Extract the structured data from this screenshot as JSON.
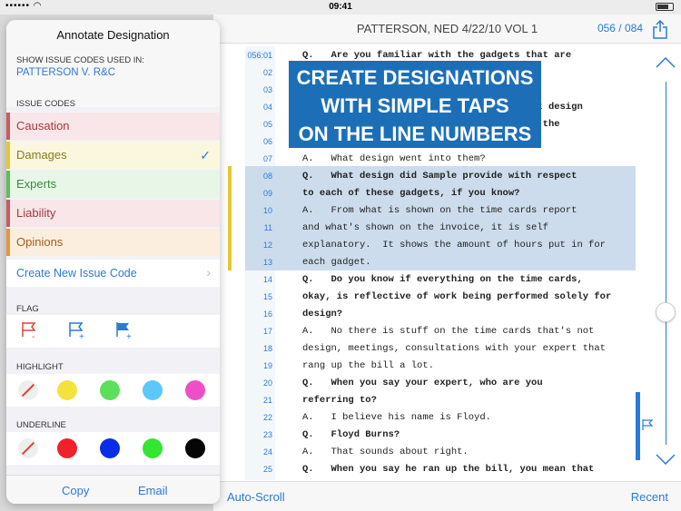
{
  "status": {
    "time": "09:41"
  },
  "doc": {
    "title": "PATTERSON, NED 4/22/10 VOL 1",
    "page": "056 / 084"
  },
  "banner": [
    "CREATE DESIGNATIONS",
    "WITH SIMPLE TAPS",
    "ON THE LINE NUMBERS"
  ],
  "lines": [
    {
      "num": "056:01",
      "text": "Q.   Are you familiar with the gadgets that are",
      "bold": true
    },
    {
      "num": "02",
      "text": "",
      "bold": false
    },
    {
      "num": "03",
      "text": "",
      "bold": false
    },
    {
      "num": "04",
      "text": "                                        at design",
      "bold": true
    },
    {
      "num": "05",
      "text": "                                        t the",
      "bold": true
    },
    {
      "num": "06",
      "text": "",
      "bold": false
    },
    {
      "num": "07",
      "text": "A.   What design went into them?",
      "bold": false
    },
    {
      "num": "08",
      "text": "Q.   What design did Sample provide with respect",
      "bold": true
    },
    {
      "num": "09",
      "text": "to each of these gadgets, if you know?",
      "bold": true
    },
    {
      "num": "10",
      "text": "A.   From what is shown on the time cards report",
      "bold": false
    },
    {
      "num": "11",
      "text": "and what's shown on the invoice, it is self",
      "bold": false
    },
    {
      "num": "12",
      "text": "explanatory.  It shows the amount of hours put in for",
      "bold": false
    },
    {
      "num": "13",
      "text": "each gadget.",
      "bold": false
    },
    {
      "num": "14",
      "text": "Q.   Do you know if everything on the time cards,",
      "bold": true
    },
    {
      "num": "15",
      "text": "okay, is reflective of work being performed solely for",
      "bold": true
    },
    {
      "num": "16",
      "text": "design?",
      "bold": true
    },
    {
      "num": "17",
      "text": "A.   No there is stuff on the time cards that's not",
      "bold": false
    },
    {
      "num": "18",
      "text": "design, meetings, consultations with your expert that",
      "bold": false
    },
    {
      "num": "19",
      "text": "rang up the bill a lot.",
      "bold": false
    },
    {
      "num": "20",
      "text": "Q.   When you say your expert, who are you",
      "bold": true
    },
    {
      "num": "21",
      "text": "referring to?",
      "bold": true
    },
    {
      "num": "22",
      "text": "A.   I believe his name is Floyd.",
      "bold": false
    },
    {
      "num": "23",
      "text": "Q.   Floyd Burns?",
      "bold": true
    },
    {
      "num": "24",
      "text": "A.   That sounds about right.",
      "bold": false
    },
    {
      "num": "25",
      "text": "Q.   When you say he ran up the bill, you mean that",
      "bold": true
    }
  ],
  "bottom": {
    "auto": "Auto-Scroll",
    "recent": "Recent"
  },
  "popover": {
    "title": "Annotate Designation",
    "show_label": "SHOW ISSUE CODES USED IN:",
    "case": "PATTERSON V. R&C",
    "issue_label": "ISSUE CODES",
    "issues": [
      {
        "label": "Causation",
        "bar": "#c85a64",
        "bg": "#f9e6e8",
        "color": "#a33a44"
      },
      {
        "label": "Damages",
        "bar": "#e4c832",
        "bg": "#fbf7df",
        "color": "#8a7a1c"
      },
      {
        "label": "Experts",
        "bar": "#5bbf5b",
        "bg": "#e7f6e7",
        "color": "#3a8a3a"
      },
      {
        "label": "Liability",
        "bar": "#c85a64",
        "bg": "#f9e6e8",
        "color": "#9a3a44"
      },
      {
        "label": "Opinions",
        "bar": "#e8963c",
        "bg": "#fbeede",
        "color": "#a05e1a"
      }
    ],
    "check": "✓",
    "create": "Create New Issue Code",
    "flag_label": "FLAG",
    "highlight_label": "HIGHLIGHT",
    "underline_label": "UNDERLINE",
    "highlight_colors": [
      "#f5e13c",
      "#5ce05c",
      "#5ac8fa",
      "#f04ec8"
    ],
    "underline_colors": [
      "#f0202c",
      "#0a2ee8",
      "#32e632",
      "#050505"
    ],
    "copy": "Copy",
    "email": "Email"
  }
}
